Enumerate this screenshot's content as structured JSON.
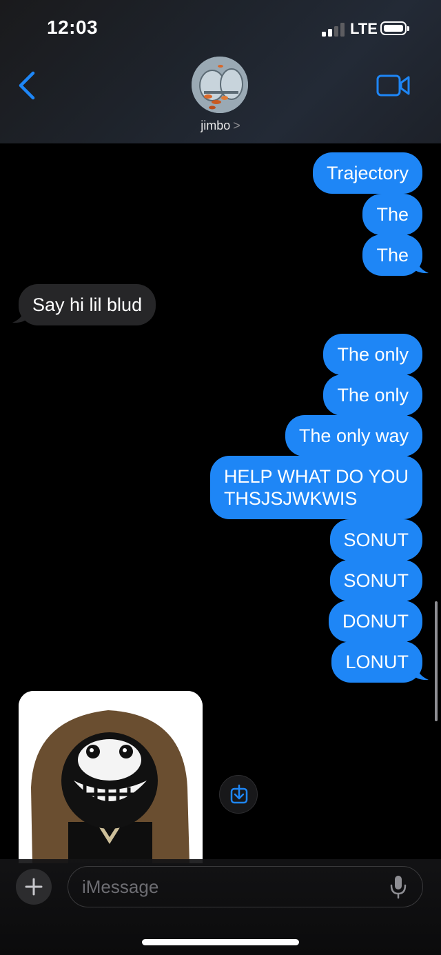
{
  "status_bar": {
    "time": "12:03",
    "carrier": "LTE"
  },
  "header": {
    "contact_name": "jimbo",
    "chevron": ">"
  },
  "messages": [
    {
      "direction": "outgoing",
      "text": "Trajectory"
    },
    {
      "direction": "outgoing",
      "text": "The"
    },
    {
      "direction": "outgoing",
      "text": "The"
    },
    {
      "direction": "incoming",
      "text": "Say hi lil blud"
    },
    {
      "direction": "outgoing",
      "text": "The only"
    },
    {
      "direction": "outgoing",
      "text": "The only"
    },
    {
      "direction": "outgoing",
      "text": "The only way"
    },
    {
      "direction": "outgoing",
      "text_line1": "HELP WHAT DO YOU",
      "text_line2": "THSJSJWKWIS"
    },
    {
      "direction": "outgoing",
      "text": "SONUT"
    },
    {
      "direction": "outgoing",
      "text": "SONUT"
    },
    {
      "direction": "outgoing",
      "text": "DONUT"
    },
    {
      "direction": "outgoing",
      "text": "LONUT"
    }
  ],
  "composer": {
    "placeholder": "iMessage",
    "plus": "+"
  },
  "colors": {
    "outgoing_bubble": "#1e86f6",
    "incoming_bubble": "#262628",
    "accent": "#1e86f6"
  },
  "icons": [
    "back-chevron-icon",
    "video-camera-icon",
    "save-download-icon",
    "microphone-icon",
    "plus-icon"
  ]
}
